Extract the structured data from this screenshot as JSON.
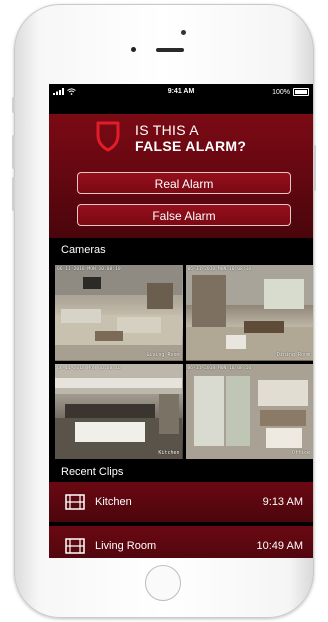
{
  "status_bar": {
    "time": "9:41 AM",
    "battery": "100%"
  },
  "alert": {
    "line1": "IS THIS A",
    "line2": "FALSE ALARM?"
  },
  "buttons": {
    "real": "Real Alarm",
    "false": "False Alarm"
  },
  "sections": {
    "cameras": "Cameras",
    "recent_clips": "Recent Clips"
  },
  "cameras": [
    {
      "timestamp": "06-11-2018 MON 10:08:10",
      "name": "Living Room"
    },
    {
      "timestamp": "06-11-2018 MON 10:08:10",
      "name": "Dining Room"
    },
    {
      "timestamp": "06-11-2018 MON 10:08:10",
      "name": "Kitchen"
    },
    {
      "timestamp": "06-11-2018 MON 10:08:10",
      "name": "Office"
    }
  ],
  "clips": [
    {
      "name": "Kitchen",
      "time": "9:13 AM"
    },
    {
      "name": "Living Room",
      "time": "10:49 AM"
    }
  ],
  "colors": {
    "accent": "#7a0a14",
    "button_border": "#e7c5c5"
  }
}
